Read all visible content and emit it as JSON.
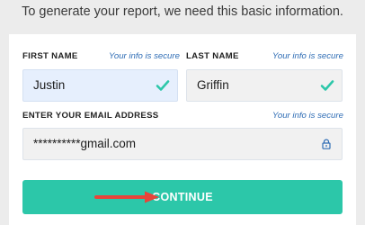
{
  "intro": {
    "text": "To generate your report, we need this basic information."
  },
  "form": {
    "secure_note": "Your info is secure",
    "first_name": {
      "label": "FIRST NAME",
      "value": "Justin",
      "valid_icon": "checkmark-icon"
    },
    "last_name": {
      "label": "LAST NAME",
      "value": "Griffin",
      "valid_icon": "checkmark-icon"
    },
    "email": {
      "label": "ENTER YOUR EMAIL ADDRESS",
      "value": "**********gmail.com",
      "icon": "lock-icon"
    },
    "continue": {
      "label": "CONTINUE",
      "annotation_icon": "red-arrow-icon"
    }
  },
  "colors": {
    "page_background": "#ececec",
    "card_background": "#ffffff",
    "accent_teal": "#2cc7a9",
    "secure_blue": "#2f6db5",
    "active_field": "#e6effd",
    "annotation_arrow": "#e8443a"
  }
}
